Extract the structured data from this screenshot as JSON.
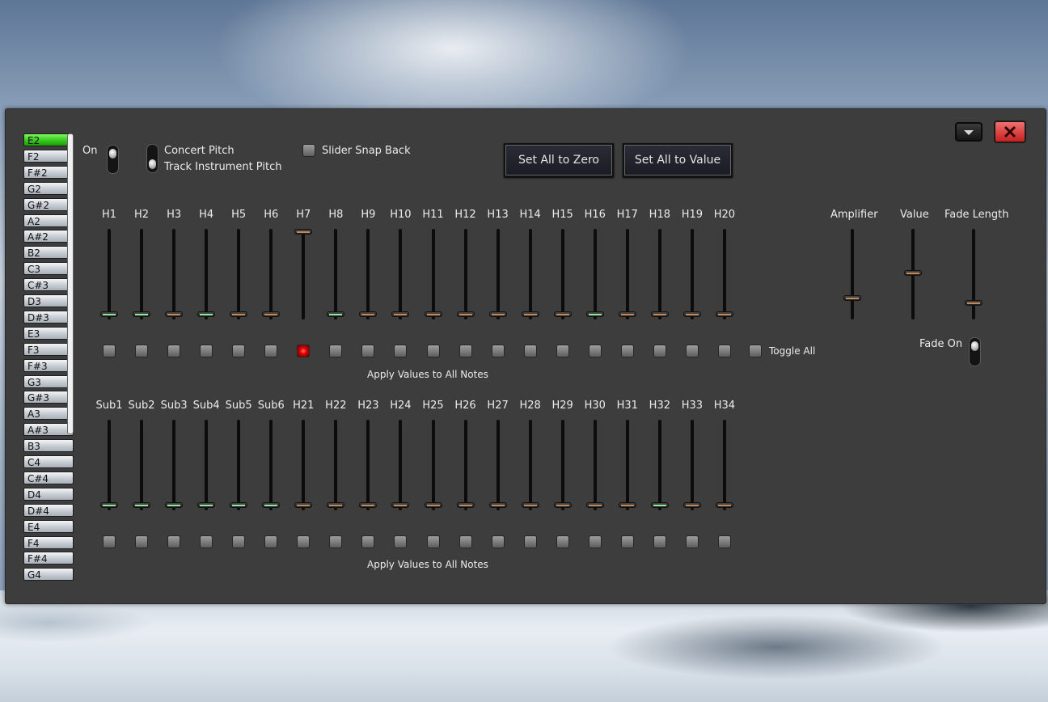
{
  "notes": [
    {
      "label": "E2",
      "selected": true
    },
    {
      "label": "F2"
    },
    {
      "label": "F#2"
    },
    {
      "label": "G2"
    },
    {
      "label": "G#2"
    },
    {
      "label": "A2"
    },
    {
      "label": "A#2"
    },
    {
      "label": "B2"
    },
    {
      "label": "C3"
    },
    {
      "label": "C#3"
    },
    {
      "label": "D3"
    },
    {
      "label": "D#3"
    },
    {
      "label": "E3"
    },
    {
      "label": "F3"
    },
    {
      "label": "F#3"
    },
    {
      "label": "G3"
    },
    {
      "label": "G#3"
    },
    {
      "label": "A3"
    },
    {
      "label": "A#3"
    },
    {
      "label": "B3"
    },
    {
      "label": "C4"
    },
    {
      "label": "C#4"
    },
    {
      "label": "D4"
    },
    {
      "label": "D#4"
    },
    {
      "label": "E4"
    },
    {
      "label": "F4"
    },
    {
      "label": "F#4"
    },
    {
      "label": "G4"
    }
  ],
  "toolbar": {
    "on_label": "On",
    "concert_pitch_label": "Concert Pitch",
    "track_pitch_label": "Track Instrument Pitch",
    "snap_back_label": "Slider Snap Back",
    "set_zero_label": "Set All to Zero",
    "set_value_label": "Set All to Value"
  },
  "upper": {
    "headers": [
      "H1",
      "H2",
      "H3",
      "H4",
      "H5",
      "H6",
      "H7",
      "H8",
      "H9",
      "H10",
      "H11",
      "H12",
      "H13",
      "H14",
      "H15",
      "H16",
      "H17",
      "H18",
      "H19",
      "H20"
    ],
    "levels": [
      0,
      0,
      0,
      0,
      0,
      0,
      1,
      0,
      0,
      0,
      0,
      0,
      0,
      0,
      0,
      0,
      0,
      0,
      0,
      0
    ],
    "thumb_colors": [
      "green",
      "green",
      "orange",
      "green",
      "orange",
      "orange",
      "orange",
      "green",
      "orange",
      "orange",
      "orange",
      "orange",
      "orange",
      "orange",
      "orange",
      "green",
      "orange",
      "orange",
      "orange",
      "orange"
    ],
    "checks": [
      false,
      false,
      false,
      false,
      false,
      false,
      true,
      false,
      false,
      false,
      false,
      false,
      false,
      false,
      false,
      false,
      false,
      false,
      false,
      false
    ],
    "toggle_all_label": "Toggle All",
    "apply_label": "Apply Values to All Notes"
  },
  "lower": {
    "headers": [
      "Sub1",
      "Sub2",
      "Sub3",
      "Sub4",
      "Sub5",
      "Sub6",
      "H21",
      "H22",
      "H23",
      "H24",
      "H25",
      "H26",
      "H27",
      "H28",
      "H29",
      "H30",
      "H31",
      "H32",
      "H33",
      "H34"
    ],
    "levels": [
      0,
      0,
      0,
      0,
      0,
      0,
      0,
      0,
      0,
      0,
      0,
      0,
      0,
      0,
      0,
      0,
      0,
      0,
      0,
      0
    ],
    "thumb_colors": [
      "green",
      "green",
      "green",
      "green",
      "green",
      "green",
      "orange",
      "orange",
      "orange",
      "orange",
      "orange",
      "orange",
      "orange",
      "orange",
      "orange",
      "orange",
      "orange",
      "green",
      "orange",
      "orange"
    ],
    "checks": [
      false,
      false,
      false,
      false,
      false,
      false,
      false,
      false,
      false,
      false,
      false,
      false,
      false,
      false,
      false,
      false,
      false,
      false,
      false,
      false
    ],
    "apply_label": "Apply Values to All Notes"
  },
  "right": {
    "amplifier_label": "Amplifier",
    "value_label": "Value",
    "fade_length_label": "Fade Length",
    "fade_on_label": "Fade On",
    "amplifier_level": 0.2,
    "value_level": 0.5,
    "fade_length_level": 0.14
  },
  "window": {
    "minimize_icon": "chevron-down-icon",
    "close_icon": "close-icon"
  },
  "colors": {
    "panel": "#3d3d3d",
    "selected_note": "#33c21a",
    "close_button": "#e24a4a"
  }
}
